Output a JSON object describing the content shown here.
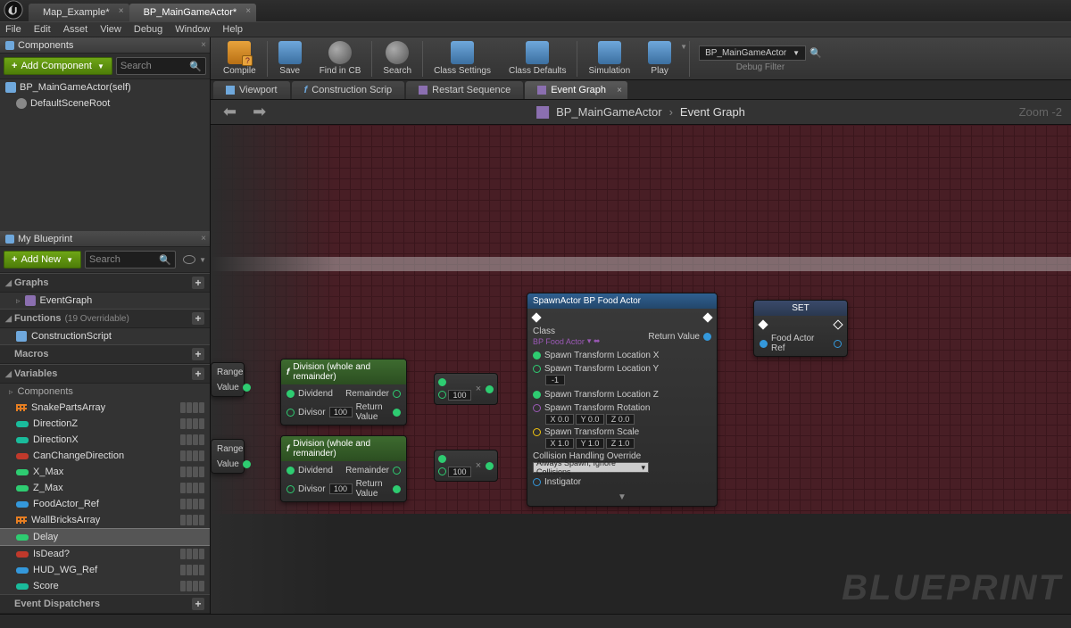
{
  "tabs": {
    "map": "Map_Example*",
    "bp": "BP_MainGameActor*"
  },
  "menu": [
    "File",
    "Edit",
    "Asset",
    "View",
    "Debug",
    "Window",
    "Help"
  ],
  "components": {
    "title": "Components",
    "add": "Add Component",
    "search_ph": "Search",
    "items": [
      "BP_MainGameActor(self)",
      "DefaultSceneRoot"
    ]
  },
  "myblueprint": {
    "title": "My Blueprint",
    "add": "Add New",
    "search_ph": "Search",
    "graphs": {
      "hdr": "Graphs",
      "items": [
        "EventGraph"
      ]
    },
    "functions": {
      "hdr": "Functions",
      "sub": "(19 Overridable)",
      "items": [
        "ConstructionScript"
      ]
    },
    "macros": {
      "hdr": "Macros"
    },
    "variables": {
      "hdr": "Variables",
      "compsub": "Components",
      "items": [
        {
          "name": "SnakePartsArray",
          "color": "#e67e22",
          "grid": true
        },
        {
          "name": "DirectionZ",
          "color": "#1abc9c"
        },
        {
          "name": "DirectionX",
          "color": "#1abc9c"
        },
        {
          "name": "CanChangeDirection",
          "color": "#c0392b"
        },
        {
          "name": "X_Max",
          "color": "#2ecc71"
        },
        {
          "name": "Z_Max",
          "color": "#2ecc71"
        },
        {
          "name": "FoodActor_Ref",
          "color": "#3498db"
        },
        {
          "name": "WallBricksArray",
          "color": "#e67e22",
          "grid": true
        },
        {
          "name": "Delay",
          "color": "#2ecc71",
          "selected": true
        },
        {
          "name": "IsDead?",
          "color": "#c0392b"
        },
        {
          "name": "HUD_WG_Ref",
          "color": "#3498db"
        },
        {
          "name": "Score",
          "color": "#1abc9c"
        }
      ]
    },
    "dispatchers": {
      "hdr": "Event Dispatchers"
    }
  },
  "toolbar": {
    "compile": "Compile",
    "save": "Save",
    "find": "Find in CB",
    "search": "Search",
    "csettings": "Class Settings",
    "cdefaults": "Class Defaults",
    "sim": "Simulation",
    "play": "Play",
    "debugsel": "BP_MainGameActor",
    "debuglbl": "Debug Filter"
  },
  "graphtabs": {
    "viewport": "Viewport",
    "cs": "Construction Scrip",
    "rs": "Restart Sequence",
    "eg": "Event Graph"
  },
  "breadcrumb": {
    "a": "BP_MainGameActor",
    "b": "Event Graph"
  },
  "zoom": "Zoom -2",
  "watermark": "BLUEPRINT",
  "nodes": {
    "rangeA": {
      "range": "Range",
      "value": "Value"
    },
    "rangeB": {
      "range": "Range",
      "value": "Value"
    },
    "div": {
      "title": "Division (whole and remainder)",
      "dividend": "Dividend",
      "divisor": "Divisor",
      "divval": "100",
      "remainder": "Remainder",
      "retval": "Return Value"
    },
    "mul": {
      "val": "100"
    },
    "spawn": {
      "title": "SpawnActor BP Food Actor",
      "class": "Class",
      "classval": "BP Food Actor",
      "stlX": "Spawn Transform Location X",
      "stlY": "Spawn Transform Location Y",
      "stlYval": "-1",
      "stlZ": "Spawn Transform Location Z",
      "rot": "Spawn Transform Rotation",
      "rotvals": [
        "X  0.0",
        "Y  0.0",
        "Z  0.0"
      ],
      "scale": "Spawn Transform Scale",
      "scalevals": [
        "X  1.0",
        "Y  1.0",
        "Z  1.0"
      ],
      "coll": "Collision Handling Override",
      "collval": "Always Spawn, Ignore Collisions",
      "inst": "Instigator",
      "retval": "Return Value"
    },
    "set": {
      "title": "SET",
      "pin": "Food Actor Ref"
    }
  }
}
